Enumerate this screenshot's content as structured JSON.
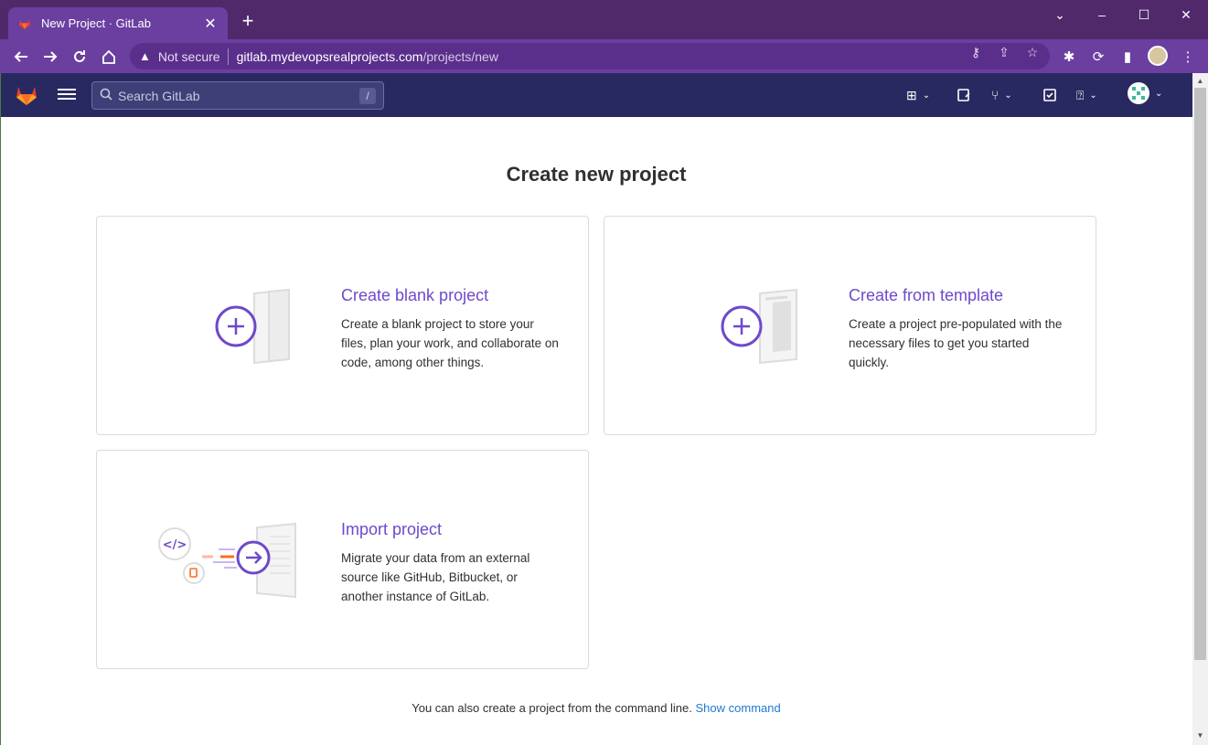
{
  "browser": {
    "tab_title": "New Project · GitLab",
    "tab_close": "✕",
    "new_tab": "+",
    "address": {
      "security_label": "Not secure",
      "host": "gitlab.mydevopsrealprojects.com",
      "path": "/projects/new"
    }
  },
  "gitlab": {
    "search_placeholder": "Search GitLab",
    "search_shortcut": "/"
  },
  "page": {
    "title": "Create new project",
    "cards": [
      {
        "title": "Create blank project",
        "description": "Create a blank project to store your files, plan your work, and collaborate on code, among other things."
      },
      {
        "title": "Create from template",
        "description": "Create a project pre-populated with the necessary files to get you started quickly."
      },
      {
        "title": "Import project",
        "description": "Migrate your data from an external source like GitHub, Bitbucket, or another instance of GitLab."
      }
    ],
    "footer_text": "You can also create a project from the command line.",
    "footer_link": "Show command"
  },
  "colors": {
    "accent": "#6e49cb",
    "nav_bg": "#292961",
    "browser_bg": "#6b3fa0",
    "link": "#1f78d1"
  }
}
